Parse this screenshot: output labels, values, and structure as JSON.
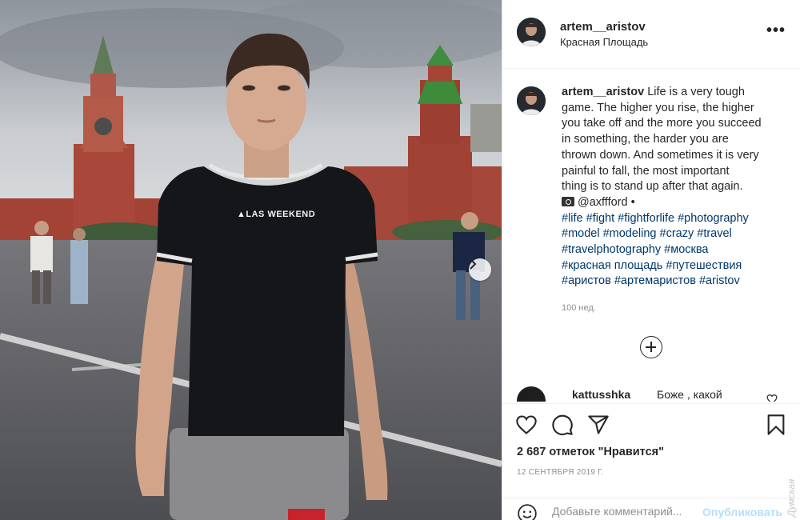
{
  "header": {
    "username": "artem__aristov",
    "location": "Красная Площадь",
    "more_label": "•••"
  },
  "photo": {
    "shirt_text": "▲LAS WEEKEND",
    "next_icon": "chevron-right-icon"
  },
  "caption": {
    "username": "artem__aristov",
    "lines": [
      " Life is a very tough",
      "game. The higher you rise, the higher",
      "you take off and the more you succeed",
      "in something, the harder you are",
      "thrown down. And sometimes it is very",
      "painful to fall, the most important",
      "thing is to stand up after that again."
    ],
    "credit": "@axffford •",
    "hashtags": [
      "#life #fight #fightforlife #photography",
      "#model #modeling #crazy #travel",
      "#travelphotography #москва",
      "#красная площадь #путешествия",
      "#аристов #артемаристов #aristov"
    ],
    "time": "100 нед."
  },
  "comments": [
    {
      "username": "kattusshka",
      "text": "Боже , какой"
    }
  ],
  "actions": {
    "likes": "2 687 отметок \"Нравится\"",
    "date": "12 СЕНТЯБРЯ 2019 Г."
  },
  "comment_bar": {
    "placeholder": "Добавьте комментарий...",
    "publish": "Опубликовать"
  },
  "watermark": "Думская",
  "colors": {
    "link": "#00376b",
    "meta": "#8e8e8e",
    "publish_disabled": "#b2dffc"
  }
}
